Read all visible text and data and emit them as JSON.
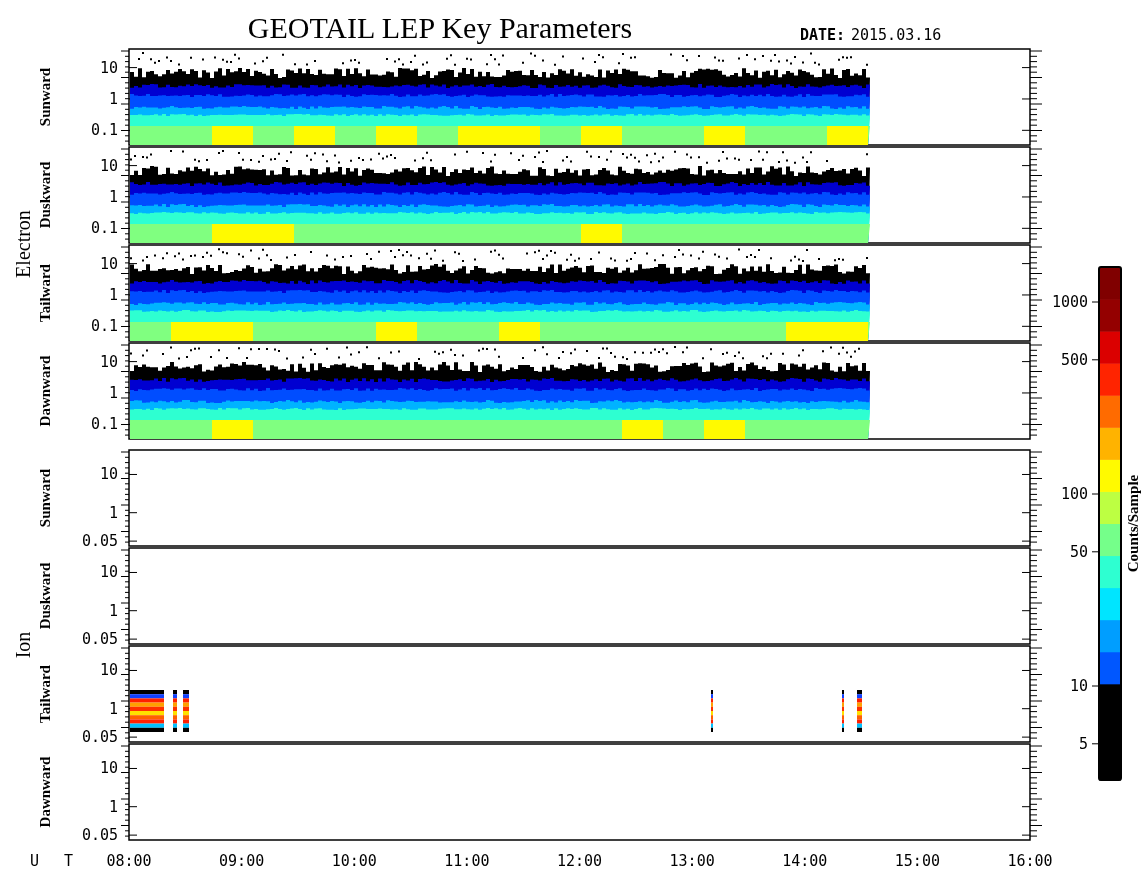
{
  "title": "GEOTAIL LEP Key Parameters",
  "date_label": "DATE:",
  "date": "2015.03.16",
  "groups": [
    {
      "label": "Electron",
      "panels": [
        {
          "label": "Sunward",
          "kind": "band",
          "yticks": [
            "10",
            "1",
            "0.1"
          ]
        },
        {
          "label": "Duskward",
          "kind": "band",
          "yticks": [
            "10",
            "1",
            "0.1"
          ]
        },
        {
          "label": "Tailward",
          "kind": "band",
          "yticks": [
            "10",
            "1",
            "0.1"
          ]
        },
        {
          "label": "Dawnward",
          "kind": "band",
          "yticks": [
            "10",
            "1",
            "0.1"
          ]
        }
      ]
    },
    {
      "label": "Ion",
      "panels": [
        {
          "label": "Sunward",
          "kind": "empty",
          "yticks": [
            "10",
            "1",
            "0.05"
          ]
        },
        {
          "label": "Duskward",
          "kind": "empty",
          "yticks": [
            "10",
            "1",
            "0.05"
          ]
        },
        {
          "label": "Tailward",
          "kind": "bursts",
          "yticks": [
            "10",
            "1",
            "0.05"
          ]
        },
        {
          "label": "Dawnward",
          "kind": "empty",
          "yticks": [
            "10",
            "1",
            "0.05"
          ]
        }
      ]
    }
  ],
  "time_axis": {
    "label": "U T",
    "ticks": [
      "08:00",
      "09:00",
      "10:00",
      "11:00",
      "12:00",
      "13:00",
      "14:00",
      "15:00",
      "16:00"
    ]
  },
  "colorbar": {
    "label": "Counts/Sample",
    "ticks": [
      "1000",
      "500",
      "100",
      "50",
      "10",
      "5"
    ]
  }
}
